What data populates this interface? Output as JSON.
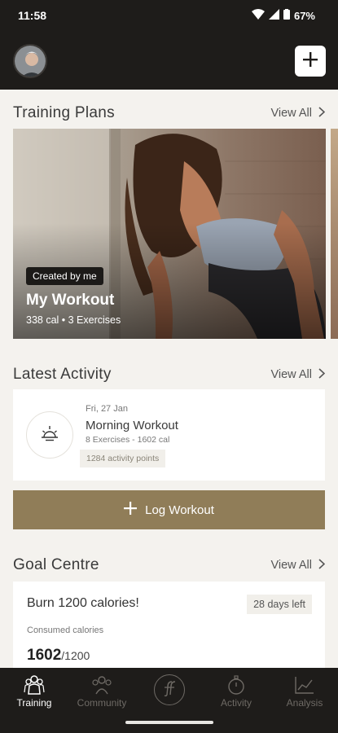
{
  "status": {
    "time": "11:58",
    "battery": "67%"
  },
  "header": {
    "avatar": "avatar-icon",
    "add_icon": "plus-icon"
  },
  "training_plans": {
    "title": "Training Plans",
    "view_all": "View All",
    "card": {
      "badge": "Created by me",
      "title": "My Workout",
      "meta": "338 cal • 3 Exercises"
    }
  },
  "latest_activity": {
    "title": "Latest Activity",
    "view_all": "View All",
    "item": {
      "date": "Fri, 27 Jan",
      "title": "Morning Workout",
      "subtitle": "8 Exercises - 1602 cal",
      "points": "1284 activity points"
    }
  },
  "log_button": {
    "label": "Log Workout"
  },
  "goal_centre": {
    "title": "Goal Centre",
    "view_all": "View All",
    "goal": {
      "title": "Burn 1200 calories!",
      "days_left": "28 days left",
      "consumed_label": "Consumed calories",
      "consumed_value": "1602",
      "consumed_total": "/1200"
    }
  },
  "tabs": [
    {
      "label": "Training",
      "icon": "training-icon",
      "active": true
    },
    {
      "label": "Community",
      "icon": "community-icon",
      "active": false
    },
    {
      "label": "",
      "icon": "brand-logo-icon",
      "active": false
    },
    {
      "label": "Activity",
      "icon": "stopwatch-icon",
      "active": false
    },
    {
      "label": "Analysis",
      "icon": "chart-icon",
      "active": false
    }
  ],
  "colors": {
    "accent": "#907d58",
    "dark": "#1e1c1a",
    "background": "#f4f2ee"
  }
}
